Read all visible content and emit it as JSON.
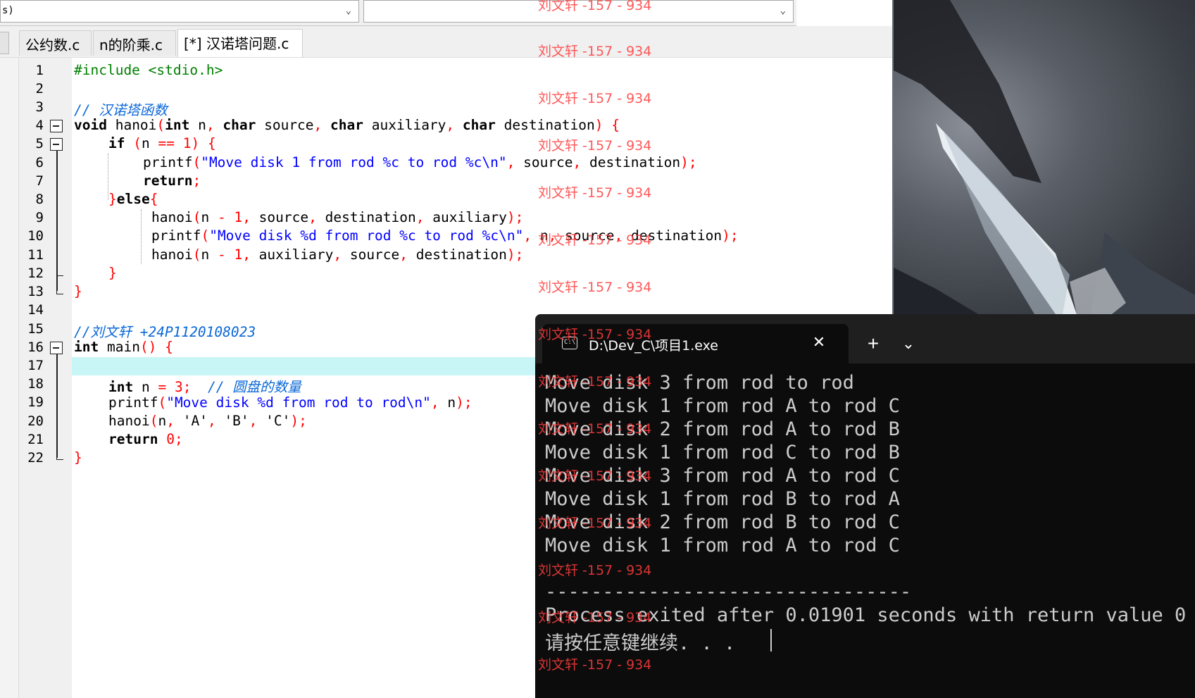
{
  "toolbar": {
    "combo_left_value": "s)",
    "combo_left_chevron": "⌄",
    "combo_right_value": "",
    "combo_right_chevron": "⌄"
  },
  "tabs": [
    {
      "label": "公约数.c",
      "active": false
    },
    {
      "label": "n的阶乘.c",
      "active": false
    },
    {
      "label": "[*] 汉诺塔问题.c",
      "active": true
    }
  ],
  "editor": {
    "line_numbers": [
      "1",
      "2",
      "3",
      "4",
      "5",
      "6",
      "7",
      "8",
      "9",
      "10",
      "11",
      "12",
      "13",
      "14",
      "15",
      "16",
      "17",
      "18",
      "19",
      "20",
      "21",
      "22"
    ],
    "current_line": "17"
  },
  "code": {
    "l1_include": "#include <stdio.h>",
    "l3_comment": "// 汉诺塔函数",
    "l4_void": "void",
    "l4_a": " hanoi",
    "l4_b": "int",
    "l4_c": " n",
    "l4_d": "char",
    "l4_e": " source",
    "l4_f": "char",
    "l4_g": " auxiliary",
    "l4_h": "char",
    "l4_i": " destination",
    "l5_if": "if",
    "l5_n": "n ",
    "l5_eq": "==",
    "l5_one": "1",
    "l6_printf": "printf",
    "l6_str": "\"Move disk 1 from rod %c to rod %c\\n\"",
    "l6_rest1": " source",
    "l6_rest2": " destination",
    "l7_return": "return",
    "l8_else": "else",
    "l9_call": "hanoi",
    "l9_n": "n ",
    "l9_minus": "-",
    "l9_one": "1",
    "l9_a": " source",
    "l9_b": " destination",
    "l9_c": " auxiliary",
    "l10_printf": "printf",
    "l10_str": "\"Move disk %d from rod %c to rod %c\\n\"",
    "l10_a": " n",
    "l10_b": " source",
    "l10_c": " destination",
    "l11_call": "hanoi",
    "l11_n": "n ",
    "l11_minus": "-",
    "l11_one": "1",
    "l11_a": " auxiliary",
    "l11_b": " source",
    "l11_c": " destination",
    "l15_comment": "//刘文轩 +24P1120108023",
    "l16_int": "int",
    "l16_main": " main",
    "l18_int": "int",
    "l18_n": " n ",
    "l18_eq": "=",
    "l18_three": "3",
    "l18_comment": "// 圆盘的数量",
    "l19_printf": "printf",
    "l19_str": "\"Move disk %d from rod to rod\\n\"",
    "l19_n": " n",
    "l20_call": "hanoi",
    "l20_n": "n",
    "l20_a": "'A'",
    "l20_b": "'B'",
    "l20_c": "'C'",
    "l21_return": "return",
    "l21_zero": "0"
  },
  "console": {
    "title": "D:\\Dev_C\\项目1.exe",
    "icon_label": "C:\\",
    "close_icon": "✕",
    "new_tab_icon": "+",
    "dropdown_icon": "⌄",
    "output": [
      "Move disk 3 from rod to rod",
      "Move disk 1 from rod A to rod C",
      "Move disk 2 from rod A to rod B",
      "Move disk 1 from rod C to rod B",
      "Move disk 3 from rod A to rod C",
      "Move disk 1 from rod B to rod A",
      "Move disk 2 from rod B to rod C",
      "Move disk 1 from rod A to rod C"
    ],
    "separator": "--------------------------------",
    "exit_message": "Process exited after 0.01901 seconds with return value 0",
    "prompt": "请按任意键继续. . ."
  },
  "watermark": "刘文轩 -157 - 934"
}
